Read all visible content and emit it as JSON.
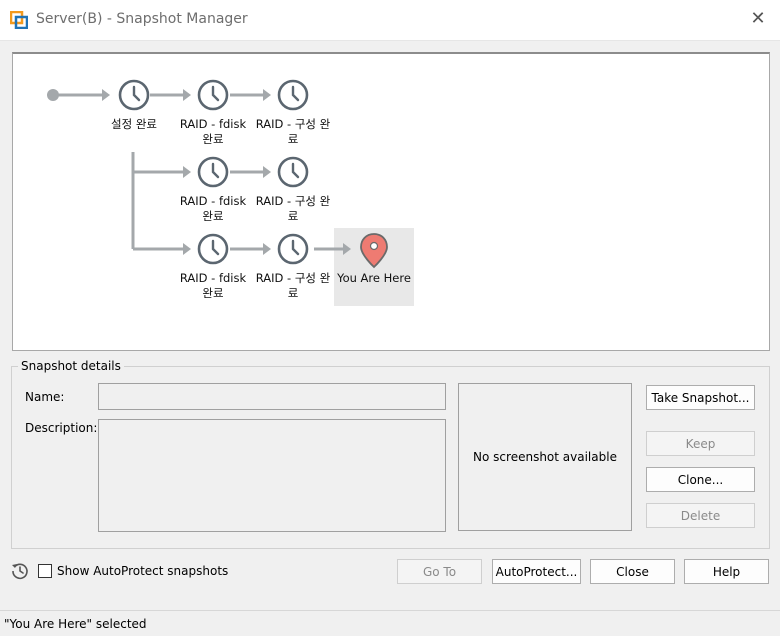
{
  "window": {
    "title": "Server(B) - Snapshot Manager"
  },
  "tree": {
    "row1": [
      "설정 완료",
      "RAID - fdisk 완료",
      "RAID - 구성 완료"
    ],
    "row2": [
      "RAID - fdisk 완료",
      "RAID - 구성 완료"
    ],
    "row3": [
      "RAID - fdisk 완료",
      "RAID - 구성 완료"
    ],
    "you_are_here": "You Are Here"
  },
  "details": {
    "group_title": "Snapshot details",
    "name_label": "Name:",
    "name_value": "",
    "description_label": "Description:",
    "description_value": "",
    "preview_text": "No screenshot available"
  },
  "buttons": {
    "take_snapshot": "Take Snapshot...",
    "keep": "Keep",
    "clone": "Clone...",
    "delete": "Delete",
    "go_to": "Go To",
    "autoprotect": "AutoProtect...",
    "close": "Close",
    "help": "Help"
  },
  "options": {
    "show_autoprotect": "Show AutoProtect snapshots"
  },
  "status": {
    "text": "\"You Are Here\" selected"
  }
}
